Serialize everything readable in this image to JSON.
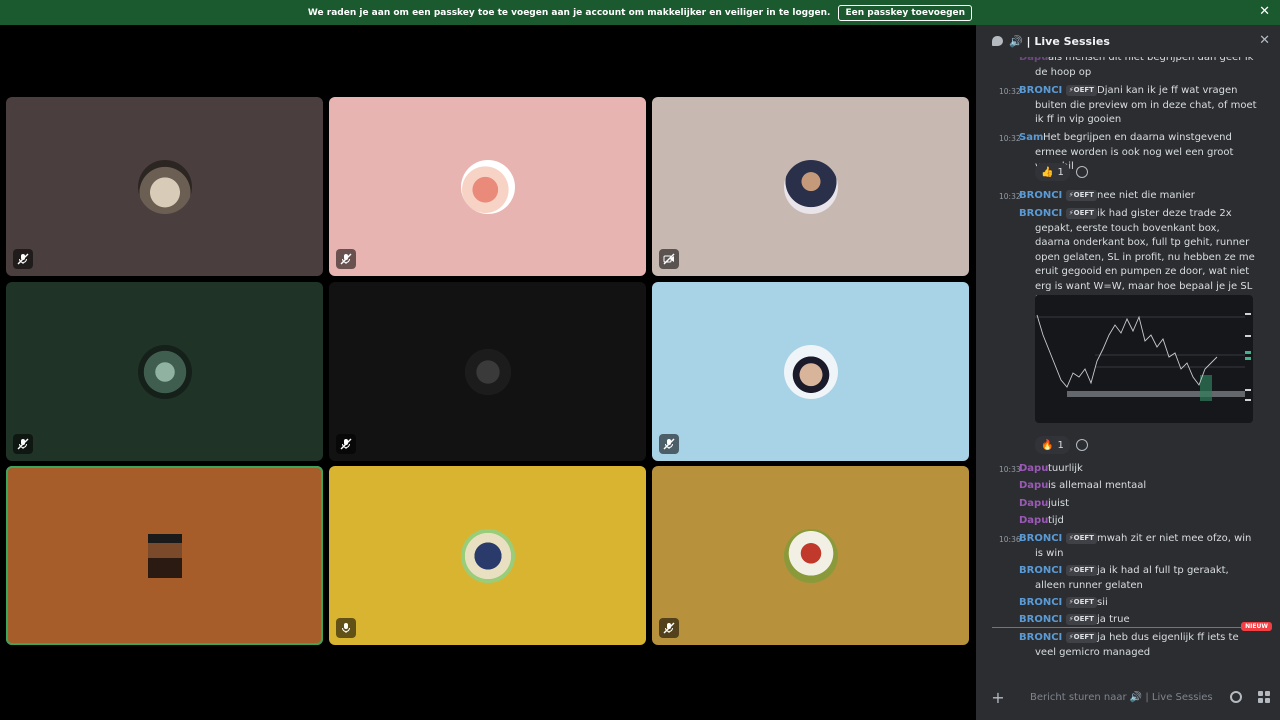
{
  "banner": {
    "text": "We raden je aan om een passkey toe te voegen aan je account om makkelijker en veiliger in te loggen.",
    "button": "Een passkey toevoegen",
    "close_icon": "close-icon"
  },
  "colors": {
    "accent_green": "#3ba55c",
    "banner_bg": "#1a5a2e",
    "unread": "#f23f43",
    "bronci": "#5b9bd5",
    "dapu": "#9b59b6",
    "sam": "#5b9bd5"
  },
  "tiles": [
    {
      "bg": "#4a3e3e",
      "mic": "muted-mic-icon"
    },
    {
      "bg": "#e8b4b2",
      "mic": "muted-mic-icon"
    },
    {
      "bg": "#c7b9b2",
      "mic": "camera-off-icon"
    },
    {
      "bg": "#1f3326",
      "mic": "muted-mic-icon"
    },
    {
      "bg": "#121212",
      "mic": "muted-mic-icon"
    },
    {
      "bg": "#a8d2e6",
      "mic": "muted-mic-icon"
    },
    {
      "bg": "#a75d2a",
      "mic": "none",
      "active": true
    },
    {
      "bg": "#d8b431",
      "mic": "mic-icon"
    },
    {
      "bg": "#b8913d",
      "mic": "muted-mic-icon"
    }
  ],
  "chat": {
    "title": "🔊 | Live Sessies",
    "messages": {
      "m0": {
        "author": "Dapu",
        "text": "als mensen dit niet begrijpen dan geef ik de hoop op"
      },
      "m1": {
        "time": "10:32",
        "author": "BRONCI",
        "tag": "⚡OEFT",
        "text": "Djani kan ik je ff wat vragen buiten die preview om in deze chat, of moet ik ff in vip gooien"
      },
      "m2": {
        "time": "10:32",
        "author": "Sam",
        "text": "Het begrijpen en daarna winstgevend ermee worden is ook nog wel een groot verschil"
      },
      "r2": {
        "emoji": "👍",
        "count": "1"
      },
      "m3": {
        "time": "10:32",
        "author": "BRONCI",
        "tag": "⚡OEFT",
        "text": "nee niet die manier"
      },
      "m4": {
        "author": "BRONCI",
        "tag": "⚡OEFT",
        "text": "ik had gister deze trade 2x gepakt, eerste touch bovenkant box, daarna onderkant box, full tp gehit, runner open gelaten, SL in profit, nu hebben ze me eruit gegooid en pumpen ze door, wat niet erg is want W=W, maar hoe bepaal je je SL in profit?"
      },
      "r4": {
        "emoji": "🔥",
        "count": "1"
      },
      "m5": {
        "time": "10:33",
        "author": "Dapu",
        "text": "tuurlijk"
      },
      "m6": {
        "author": "Dapu",
        "text": "is allemaal mentaal"
      },
      "m7": {
        "author": "Dapu",
        "text": "juist"
      },
      "m8": {
        "author": "Dapu",
        "text": "tijd"
      },
      "m9": {
        "time": "10:36",
        "author": "BRONCI",
        "tag": "⚡OEFT",
        "text": "mwah zit er niet mee ofzo, win is win"
      },
      "m10": {
        "author": "BRONCI",
        "tag": "⚡OEFT",
        "text": "ja ik had al full tp geraakt, alleen runner gelaten"
      },
      "m11": {
        "author": "BRONCI",
        "tag": "⚡OEFT",
        "text": "sii"
      },
      "m12": {
        "author": "BRONCI",
        "tag": "⚡OEFT",
        "text": "ja true"
      },
      "m13": {
        "author": "BRONCI",
        "tag": "⚡OEFT",
        "text": "ja heb dus eigenlijk ff iets te veel gemicro managed"
      }
    },
    "new_badge": "NIEUW",
    "composer_placeholder": "Bericht sturen naar 🔊 | Live Sessies"
  }
}
